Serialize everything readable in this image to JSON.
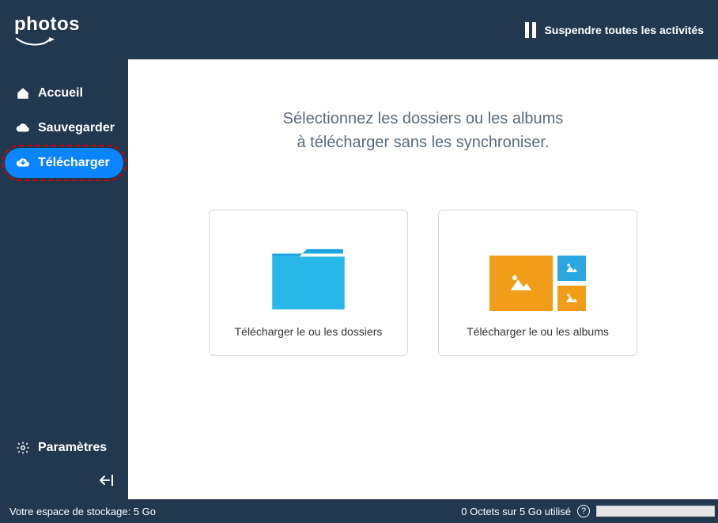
{
  "header": {
    "logo": "photos",
    "suspend_label": "Suspendre toutes les activités"
  },
  "sidebar": {
    "items": [
      {
        "label": "Accueil"
      },
      {
        "label": "Sauvegarder"
      },
      {
        "label": "Télécharger"
      }
    ],
    "settings_label": "Paramètres",
    "collapse_glyph": "←|"
  },
  "content": {
    "lead_line1": "Sélectionnez les dossiers ou les albums",
    "lead_line2": "à télécharger sans les synchroniser.",
    "card_folders_label": "Télécharger le ou les dossiers",
    "card_albums_label": "Télécharger le ou les albums"
  },
  "footer": {
    "storage_text": "Votre espace de stockage: 5 Go",
    "usage_text": "0 Octets sur 5 Go utilisé",
    "help_glyph": "?"
  }
}
